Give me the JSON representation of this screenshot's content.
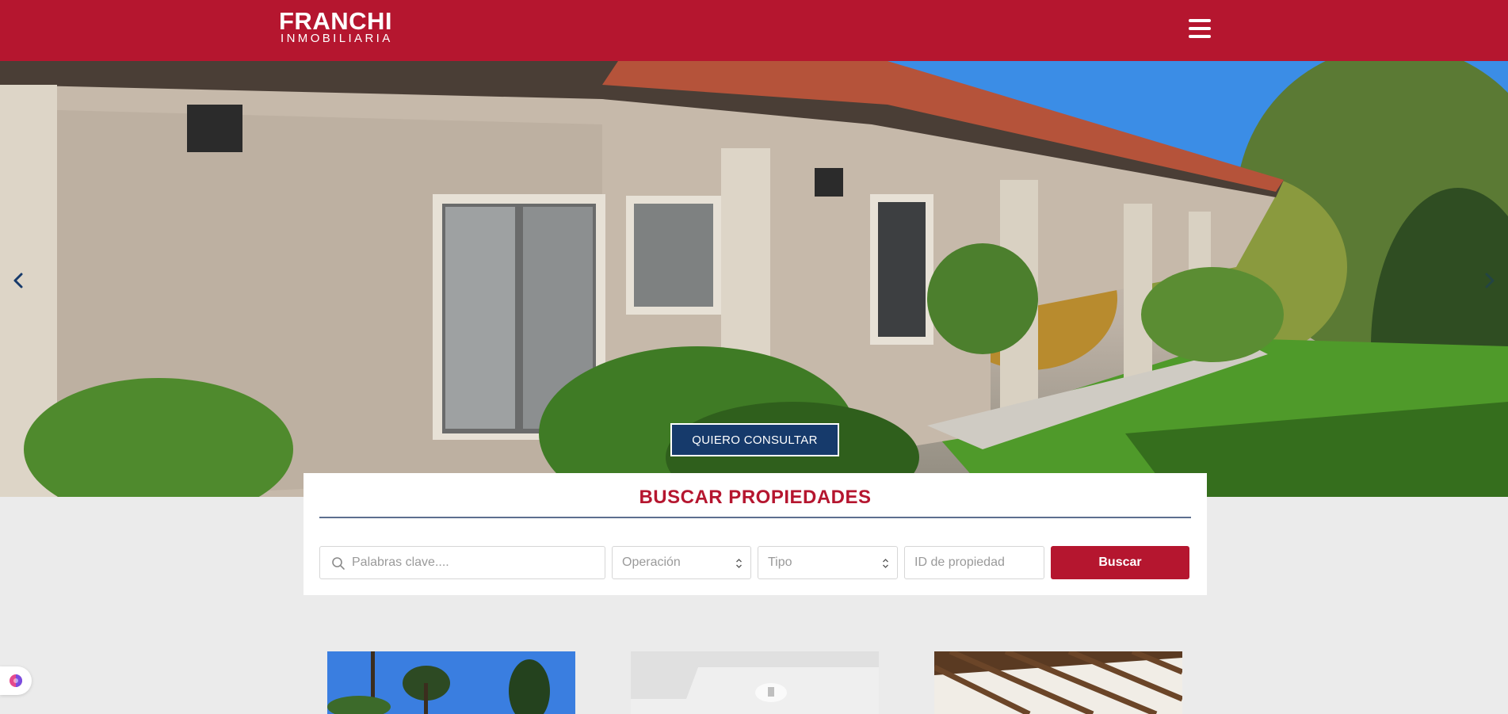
{
  "header": {
    "logo_main": "FRANCHI",
    "logo_sub": "INMOBILIARIA",
    "menu_icon": "hamburger-menu-icon",
    "background_color": "#b5162f"
  },
  "hero": {
    "consult_button": "QUIERO CONSULTAR",
    "prev_icon": "chevron-left-icon",
    "next_icon": "chevron-right-icon"
  },
  "search": {
    "title": "BUSCAR PROPIEDADES",
    "keywords_placeholder": "Palabras clave....",
    "operation_label": "Operación",
    "type_label": "Tipo",
    "id_placeholder": "ID de propiedad",
    "submit_label": "Buscar",
    "accent_color": "#b5162f"
  },
  "listings": {
    "card_count": 3
  },
  "accessibility_widget": {
    "icon": "brain-icon"
  }
}
